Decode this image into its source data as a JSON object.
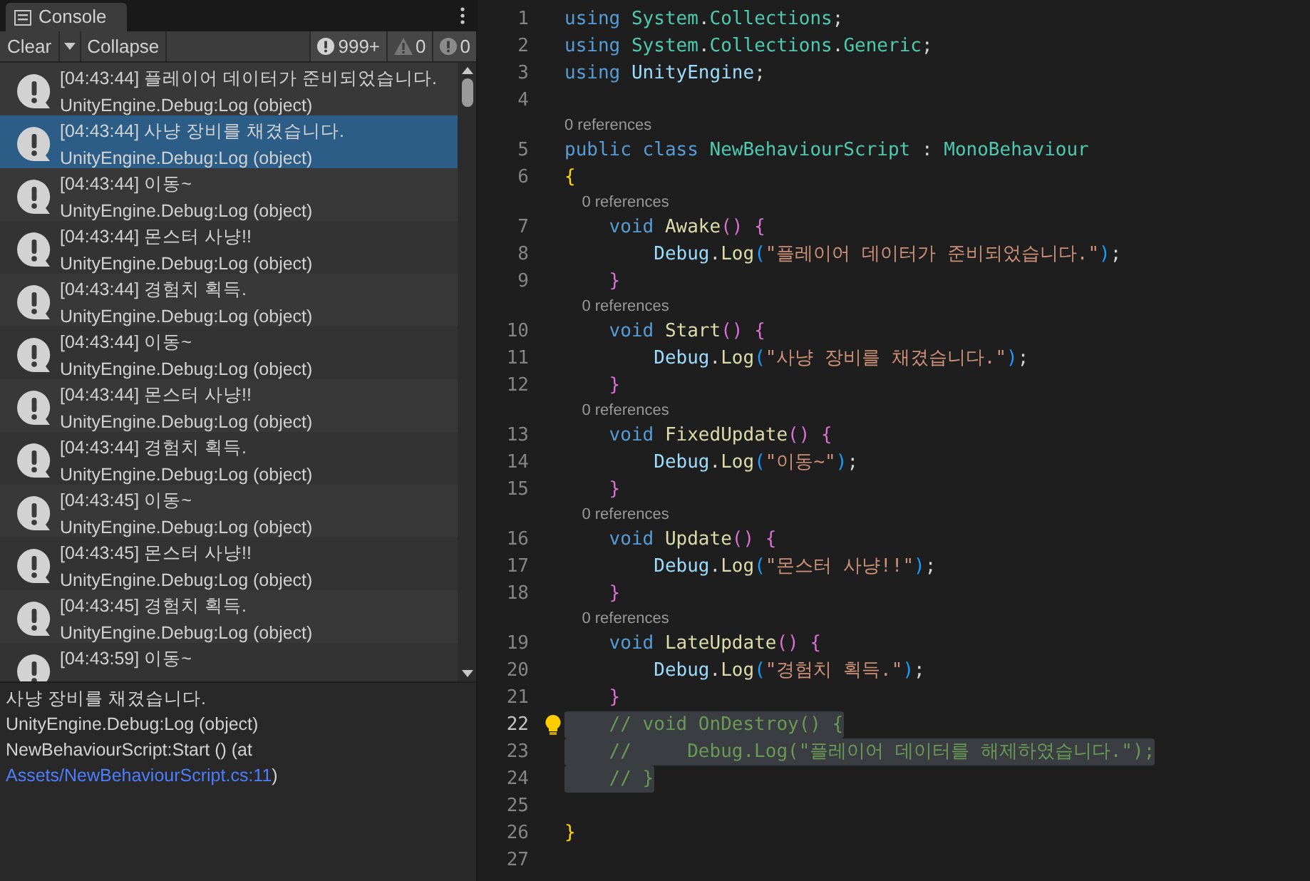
{
  "console": {
    "tab": "Console",
    "toolbar": {
      "clear": "Clear",
      "collapse": "Collapse",
      "counts": [
        {
          "kind": "log",
          "text": "999+"
        },
        {
          "kind": "warning",
          "text": "0"
        },
        {
          "kind": "error",
          "text": "0"
        }
      ]
    },
    "entries": [
      {
        "line1": "[04:43:44] 플레이어 데이터가 준비되었습니다.",
        "line2": "UnityEngine.Debug:Log (object)",
        "selected": false
      },
      {
        "line1": "[04:43:44] 사냥 장비를 채겼습니다.",
        "line2": "UnityEngine.Debug:Log (object)",
        "selected": true
      },
      {
        "line1": "[04:43:44] 이동~",
        "line2": "UnityEngine.Debug:Log (object)",
        "selected": false
      },
      {
        "line1": "[04:43:44] 몬스터 사냥!!",
        "line2": "UnityEngine.Debug:Log (object)",
        "selected": false
      },
      {
        "line1": "[04:43:44] 경험치 획득.",
        "line2": "UnityEngine.Debug:Log (object)",
        "selected": false
      },
      {
        "line1": "[04:43:44] 이동~",
        "line2": "UnityEngine.Debug:Log (object)",
        "selected": false
      },
      {
        "line1": "[04:43:44] 몬스터 사냥!!",
        "line2": "UnityEngine.Debug:Log (object)",
        "selected": false
      },
      {
        "line1": "[04:43:44] 경험치 획득.",
        "line2": "UnityEngine.Debug:Log (object)",
        "selected": false
      },
      {
        "line1": "[04:43:45] 이동~",
        "line2": "UnityEngine.Debug:Log (object)",
        "selected": false
      },
      {
        "line1": "[04:43:45] 몬스터 사냥!!",
        "line2": "UnityEngine.Debug:Log (object)",
        "selected": false
      },
      {
        "line1": "[04:43:45] 경험치 획득.",
        "line2": "UnityEngine.Debug:Log (object)",
        "selected": false
      },
      {
        "line1": "[04:43:59] 이동~",
        "selected": false
      }
    ],
    "detail": {
      "lines": [
        "사냥 장비를 채겼습니다.",
        "UnityEngine.Debug:Log (object)",
        "NewBehaviourScript:Start () (at"
      ],
      "link": "Assets/NewBehaviourScript.cs:11",
      "after_link": ")"
    }
  },
  "editor": {
    "lines": [
      {
        "number": "1",
        "tokens": [
          {
            "kind": "keyword",
            "text": "using "
          },
          {
            "kind": "type",
            "text": "System"
          },
          {
            "kind": "plain",
            "text": "."
          },
          {
            "kind": "type",
            "text": "Collections"
          },
          {
            "kind": "plain",
            "text": ";"
          }
        ]
      },
      {
        "number": "2",
        "tokens": [
          {
            "kind": "keyword",
            "text": "using "
          },
          {
            "kind": "type",
            "text": "System"
          },
          {
            "kind": "plain",
            "text": "."
          },
          {
            "kind": "type",
            "text": "Collections"
          },
          {
            "kind": "plain",
            "text": "."
          },
          {
            "kind": "type",
            "text": "Generic"
          },
          {
            "kind": "plain",
            "text": ";"
          }
        ]
      },
      {
        "number": "3",
        "tokens": [
          {
            "kind": "keyword",
            "text": "using "
          },
          {
            "kind": "ident",
            "text": "UnityEngine"
          },
          {
            "kind": "plain",
            "text": ";"
          }
        ]
      },
      {
        "number": "4"
      },
      {
        "number": "5",
        "codelens": "0 references",
        "tokens": [
          {
            "kind": "keyword",
            "text": "public class "
          },
          {
            "kind": "type",
            "text": "NewBehaviourScript"
          },
          {
            "kind": "plain",
            "text": " : "
          },
          {
            "kind": "type",
            "text": "MonoBehaviour"
          }
        ]
      },
      {
        "number": "6",
        "tokens": [
          {
            "kind": "brace1",
            "text": "{"
          }
        ]
      },
      {
        "number": "7",
        "codelens": "    0 references",
        "tokens": [
          {
            "kind": "keyword",
            "text": "    void "
          },
          {
            "kind": "method",
            "text": "Awake"
          },
          {
            "kind": "brace2",
            "text": "() {"
          }
        ]
      },
      {
        "number": "8",
        "tokens": [
          {
            "kind": "ident",
            "text": "        Debug"
          },
          {
            "kind": "plain",
            "text": "."
          },
          {
            "kind": "method",
            "text": "Log"
          },
          {
            "kind": "brace3",
            "text": "("
          },
          {
            "kind": "string",
            "text": "\"플레이어 데이터가 준비되었습니다.\""
          },
          {
            "kind": "brace3",
            "text": ")"
          },
          {
            "kind": "plain",
            "text": ";"
          }
        ]
      },
      {
        "number": "9",
        "tokens": [
          {
            "kind": "brace2",
            "text": "    }"
          }
        ]
      },
      {
        "number": "10",
        "codelens": "    0 references",
        "tokens": [
          {
            "kind": "keyword",
            "text": "    void "
          },
          {
            "kind": "method",
            "text": "Start"
          },
          {
            "kind": "brace2",
            "text": "() {"
          }
        ]
      },
      {
        "number": "11",
        "tokens": [
          {
            "kind": "ident",
            "text": "        Debug"
          },
          {
            "kind": "plain",
            "text": "."
          },
          {
            "kind": "method",
            "text": "Log"
          },
          {
            "kind": "brace3",
            "text": "("
          },
          {
            "kind": "string",
            "text": "\"사냥 장비를 채겼습니다.\""
          },
          {
            "kind": "brace3",
            "text": ")"
          },
          {
            "kind": "plain",
            "text": ";"
          }
        ]
      },
      {
        "number": "12",
        "tokens": [
          {
            "kind": "brace2",
            "text": "    }"
          }
        ]
      },
      {
        "number": "13",
        "codelens": "    0 references",
        "tokens": [
          {
            "kind": "keyword",
            "text": "    void "
          },
          {
            "kind": "method",
            "text": "FixedUpdate"
          },
          {
            "kind": "brace2",
            "text": "() {"
          }
        ]
      },
      {
        "number": "14",
        "tokens": [
          {
            "kind": "ident",
            "text": "        Debug"
          },
          {
            "kind": "plain",
            "text": "."
          },
          {
            "kind": "method",
            "text": "Log"
          },
          {
            "kind": "brace3",
            "text": "("
          },
          {
            "kind": "string",
            "text": "\"이동~\""
          },
          {
            "kind": "brace3",
            "text": ")"
          },
          {
            "kind": "plain",
            "text": ";"
          }
        ]
      },
      {
        "number": "15",
        "tokens": [
          {
            "kind": "brace2",
            "text": "    }"
          }
        ]
      },
      {
        "number": "16",
        "codelens": "    0 references",
        "tokens": [
          {
            "kind": "keyword",
            "text": "    void "
          },
          {
            "kind": "method",
            "text": "Update"
          },
          {
            "kind": "brace2",
            "text": "() {"
          }
        ]
      },
      {
        "number": "17",
        "tokens": [
          {
            "kind": "ident",
            "text": "        Debug"
          },
          {
            "kind": "plain",
            "text": "."
          },
          {
            "kind": "method",
            "text": "Log"
          },
          {
            "kind": "brace3",
            "text": "("
          },
          {
            "kind": "string",
            "text": "\"몬스터 사냥!!\""
          },
          {
            "kind": "brace3",
            "text": ")"
          },
          {
            "kind": "plain",
            "text": ";"
          }
        ]
      },
      {
        "number": "18",
        "tokens": [
          {
            "kind": "brace2",
            "text": "    }"
          }
        ]
      },
      {
        "number": "19",
        "codelens": "    0 references",
        "tokens": [
          {
            "kind": "keyword",
            "text": "    void "
          },
          {
            "kind": "method",
            "text": "LateUpdate"
          },
          {
            "kind": "brace2",
            "text": "() {"
          }
        ]
      },
      {
        "number": "20",
        "tokens": [
          {
            "kind": "ident",
            "text": "        Debug"
          },
          {
            "kind": "plain",
            "text": "."
          },
          {
            "kind": "method",
            "text": "Log"
          },
          {
            "kind": "brace3",
            "text": "("
          },
          {
            "kind": "string",
            "text": "\"경험치 획득.\""
          },
          {
            "kind": "brace3",
            "text": ")"
          },
          {
            "kind": "plain",
            "text": ";"
          }
        ]
      },
      {
        "number": "21",
        "tokens": [
          {
            "kind": "brace2",
            "text": "    }"
          }
        ]
      },
      {
        "number": "22",
        "current": true,
        "hint": true,
        "selected": true,
        "tokens": [
          {
            "kind": "comment",
            "text": "    // void OnDestroy() {"
          }
        ]
      },
      {
        "number": "23",
        "selected": true,
        "tokens": [
          {
            "kind": "comment",
            "text": "    //     Debug.Log(\"플레이어 데이터를 해제하였습니다.\");"
          }
        ]
      },
      {
        "number": "24",
        "selected": true,
        "tokens": [
          {
            "kind": "comment",
            "text": "    // }"
          }
        ]
      },
      {
        "number": "25"
      },
      {
        "number": "26",
        "tokens": [
          {
            "kind": "brace1",
            "text": "}"
          }
        ]
      },
      {
        "number": "27"
      }
    ]
  }
}
